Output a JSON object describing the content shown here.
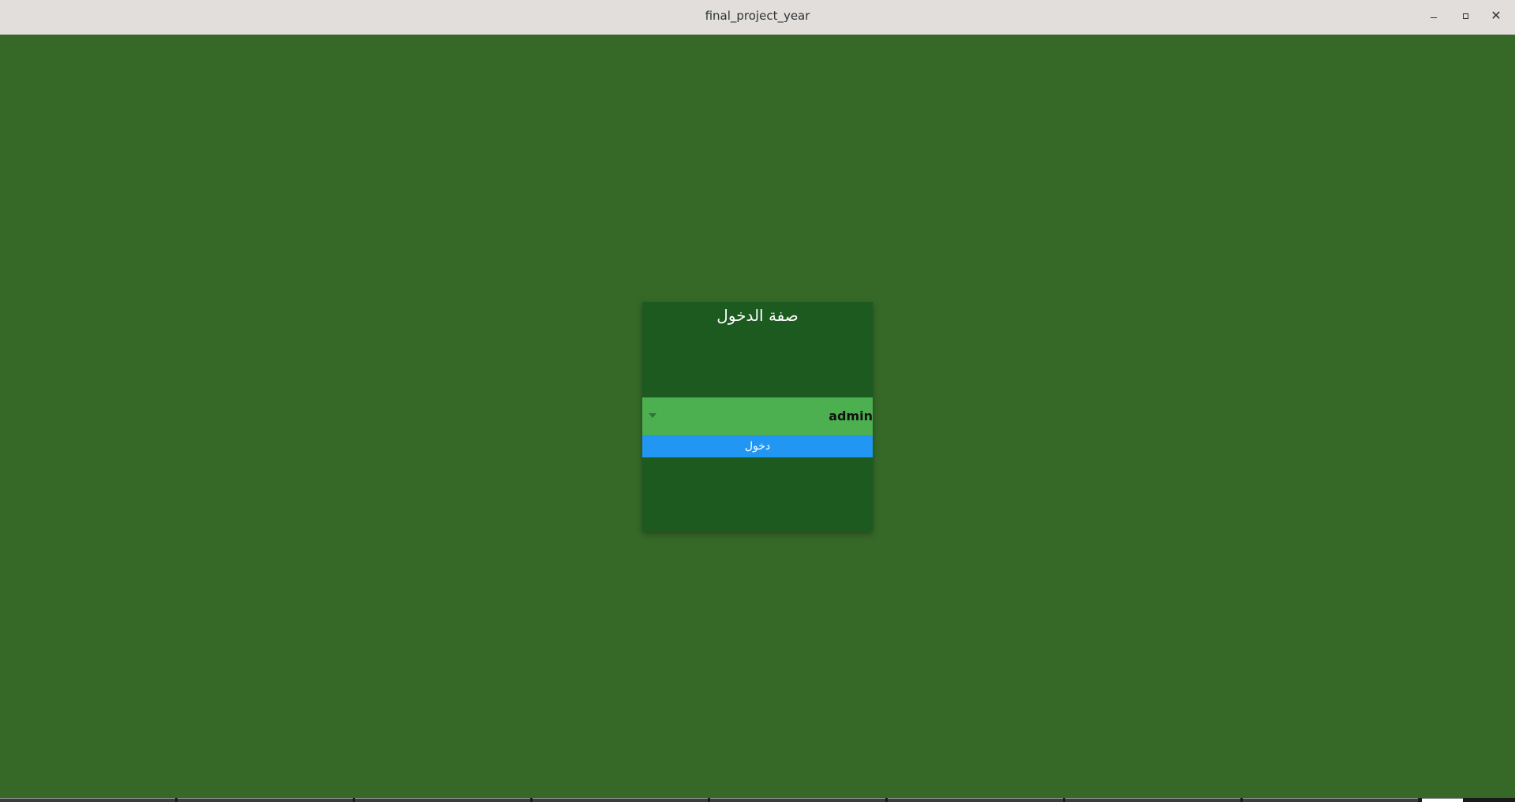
{
  "window": {
    "title": "final_project_year",
    "controls": {
      "minimize_icon": "minimize-icon",
      "maximize_icon": "maximize-icon",
      "close_icon": "close-icon",
      "close_glyph": "✕"
    }
  },
  "login_card": {
    "title": "صفة الدخول",
    "role_select": {
      "selected_value": "admin",
      "arrow_icon": "dropdown-arrow-icon"
    },
    "submit_label": "دخول"
  },
  "colors": {
    "background": "#366928",
    "card": "#1c5a20",
    "dropdown": "#4caf50",
    "button": "#2196f3",
    "titlebar": "#e1dedb"
  },
  "taskbar": {
    "segment_count": 9
  }
}
